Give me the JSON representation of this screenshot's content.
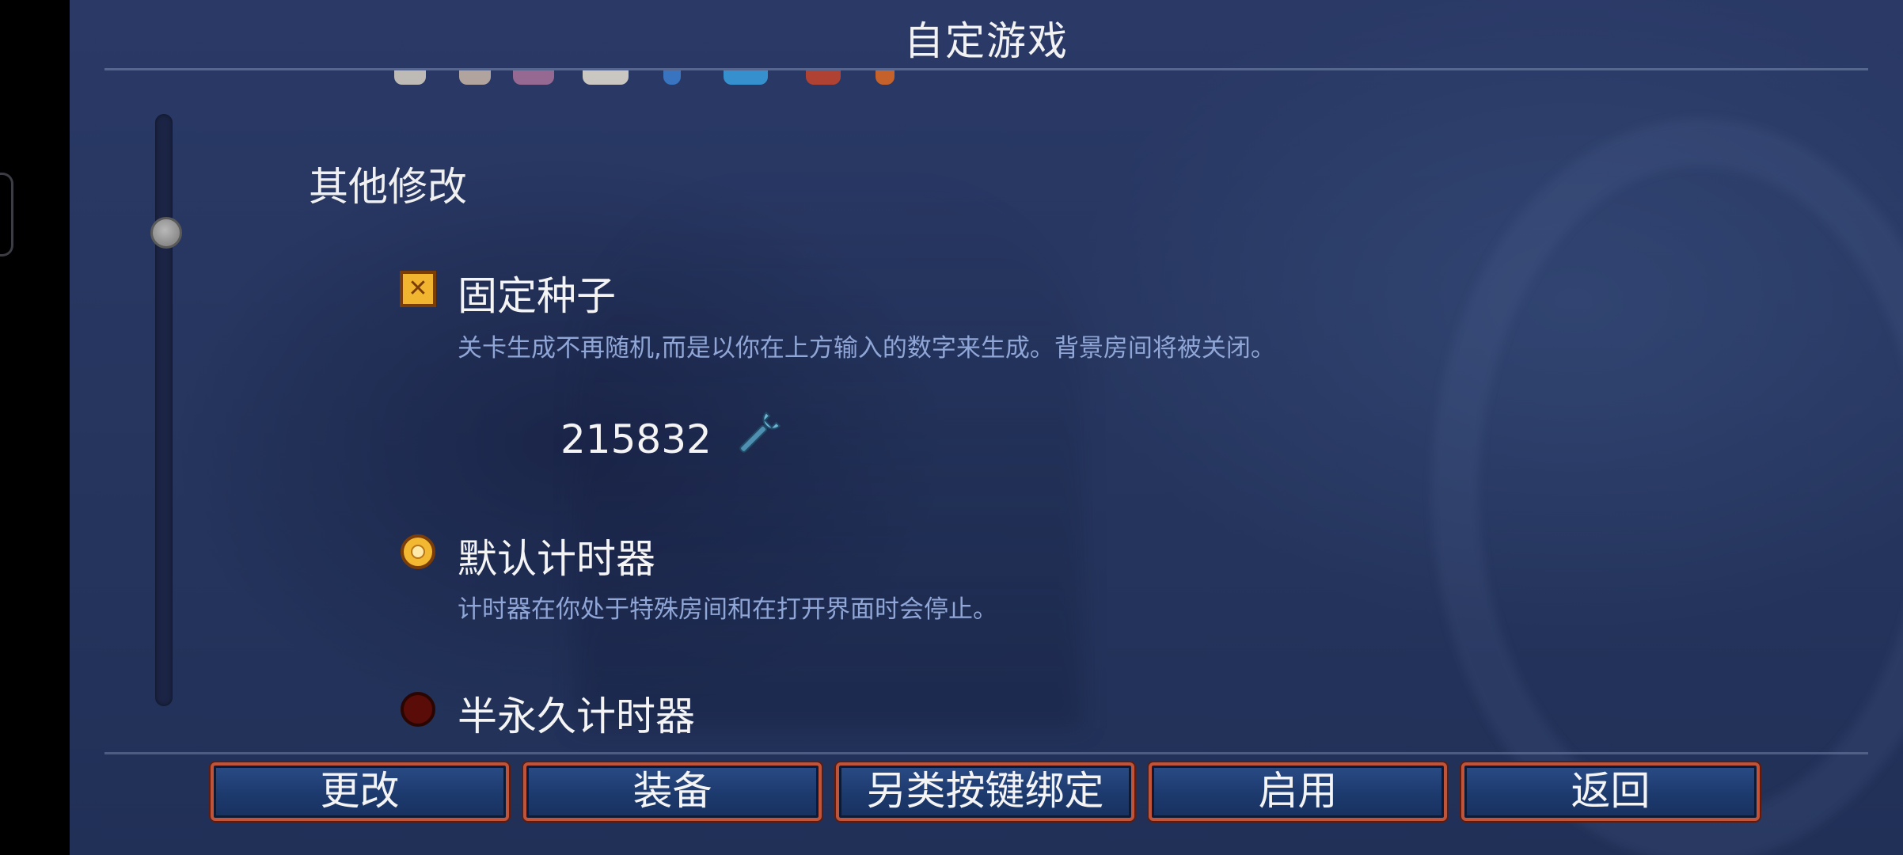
{
  "header": {
    "title": "自定游戏"
  },
  "section": {
    "title": "其他修改"
  },
  "options": {
    "fixed_seed": {
      "label": "固定种子",
      "checked": true,
      "description": "关卡生成不再随机,而是以你在上方输入的数字来生成。背景房间将被关闭。",
      "seed_value": "215832",
      "edit_icon": "wrench-icon"
    },
    "default_timer": {
      "label": "默认计时器",
      "selected": true,
      "description": "计时器在你处于特殊房间和在打开界面时会停止。"
    },
    "semi_permanent_timer": {
      "label": "半永久计时器",
      "selected": false
    }
  },
  "footer": {
    "buttons": [
      "更改",
      "装备",
      "另类按键绑定",
      "启用",
      "返回"
    ]
  },
  "colors": {
    "accent_gold": "#f2b530",
    "button_border": "#c0543a",
    "description_text": "#8fa6d6"
  }
}
